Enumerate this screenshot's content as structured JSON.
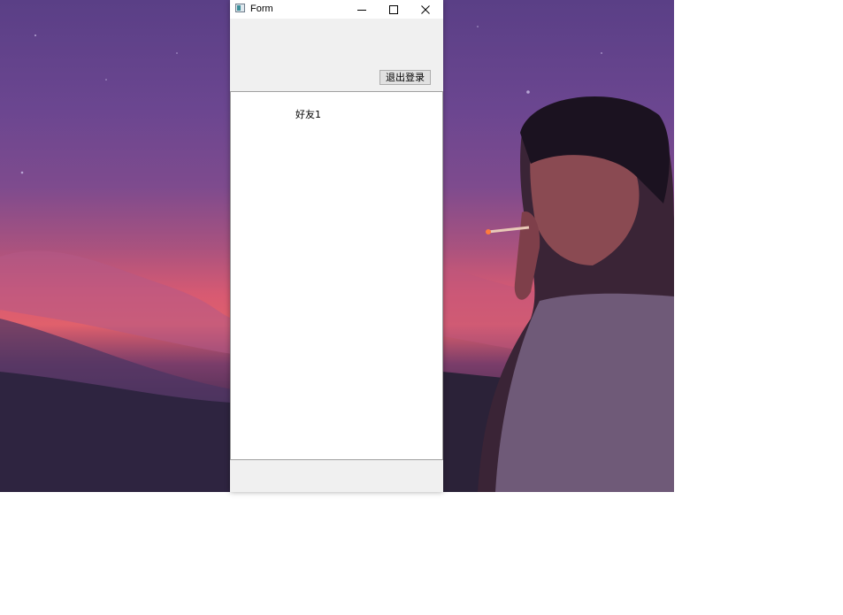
{
  "window": {
    "title": "Form",
    "app_icon": "form-app-icon",
    "controls": [
      "minimize-icon",
      "maximize-icon",
      "close-icon"
    ]
  },
  "toolbar": {
    "logout_label": "退出登录"
  },
  "friends": {
    "items": [
      {
        "label": "好友1"
      }
    ]
  },
  "colors": {
    "window_bg": "#f0f0f0",
    "titlebar_bg": "#ffffff",
    "list_bg": "#ffffff",
    "button_bg": "#e1e1e1",
    "wallpaper_top": "#5a3f86",
    "wallpaper_glow": "#e0606c"
  }
}
